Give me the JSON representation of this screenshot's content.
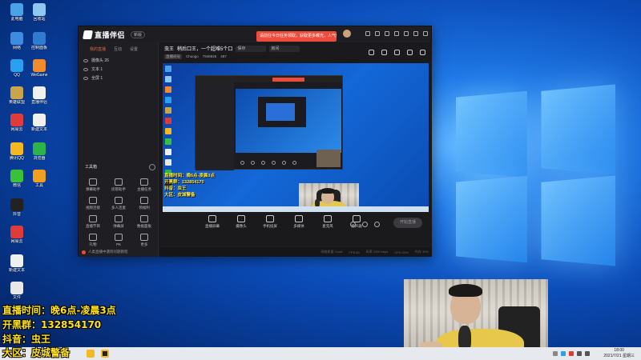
{
  "app": {
    "title": "直播伴侣",
    "version": "新版",
    "notice": "请前往今日任务领取，获取更多曝光，人气值",
    "side_tabs": [
      "我的直播",
      "互动",
      "设置"
    ],
    "scenes": [
      {
        "label": "摄像头 26"
      },
      {
        "label": "文本 1"
      },
      {
        "label": "全屏 1"
      }
    ],
    "toolbox_title": "工具箱",
    "tools": [
      {
        "label": "弹幕助手"
      },
      {
        "label": "房管助手"
      },
      {
        "label": "主播任务"
      },
      {
        "label": "视频连接"
      },
      {
        "label": "多人连麦"
      },
      {
        "label": "领福利"
      },
      {
        "label": "直播节目"
      },
      {
        "label": "弹幕屏"
      },
      {
        "label": "数据面板"
      },
      {
        "label": "礼物"
      },
      {
        "label": "PK"
      },
      {
        "label": "更多"
      }
    ],
    "footer": "人类直播中遇到问题教程",
    "room": {
      "host_label": "虫王",
      "title_value": "稍后口王，一个超难5个口",
      "field1": "保存",
      "field2": "房间"
    },
    "room_meta": {
      "tag": "直播间号",
      "nick": "Chuogo",
      "id": "7946925",
      "viewers": "487"
    },
    "controls": [
      {
        "label": "直播屏幕"
      },
      {
        "label": "摄像头"
      },
      {
        "label": "手机投屏"
      },
      {
        "label": "多媒体"
      },
      {
        "label": "麦克风"
      },
      {
        "label": "扬声器"
      }
    ],
    "start_button": "开始直播",
    "status": [
      "网络质量 Good",
      "FPS 60",
      "码率 2000 kbps",
      "CPU 20%",
      "内存 30%"
    ]
  },
  "preview_overlay": {
    "line1": "直播时间：晚6点-凌晨3点",
    "line2": "开黑群：132854170",
    "line3": "抖音：虫王",
    "line4": "大区：皮城警备"
  },
  "stream_overlay": {
    "line1": "直播时间：晚6点-凌晨3点",
    "line2": "开黑群：132854170",
    "line3": "抖音：虫王",
    "line4": "大区：皮城警备"
  },
  "desktop_icons": [
    {
      "label": "此电脑",
      "color": "#4aa3e8"
    },
    {
      "label": "回收站",
      "color": "#8ec8f0"
    },
    {
      "label": "网络",
      "color": "#3c8de0"
    },
    {
      "label": "控制面板",
      "color": "#2e7bd0"
    },
    {
      "label": "QQ",
      "color": "#2aa0f0"
    },
    {
      "label": "WeGame",
      "color": "#f28a2e"
    },
    {
      "label": "英雄联盟",
      "color": "#c9a44a"
    },
    {
      "label": "直播伴侣",
      "color": "#f0f0f0"
    },
    {
      "label": "网易云",
      "color": "#e03a3a"
    },
    {
      "label": "新建文本",
      "color": "#f0f0f0"
    },
    {
      "label": "文件",
      "color": "#e8e8e8"
    },
    {
      "label": "抖音",
      "color": "#222222"
    },
    {
      "label": "腾讯QQ",
      "color": "#f5b820"
    },
    {
      "label": "浏览器",
      "color": "#2cb34a"
    },
    {
      "label": "微信",
      "color": "#3ac13a"
    },
    {
      "label": "工具",
      "color": "#f0a020"
    }
  ],
  "taskbar": {
    "time": "18:00",
    "date": "2021/7/21 星期三"
  },
  "colors": {
    "accent": "#f04c3e",
    "overlay_yellow": "#ffe21c",
    "app_bg": "#1b1b1f",
    "shirt": "#e7c84a"
  }
}
